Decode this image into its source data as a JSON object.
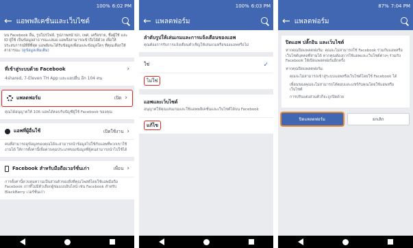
{
  "status": [
    {
      "time": "6:02 PM",
      "battery": "100%"
    },
    {
      "time": "6:03 PM",
      "battery": "100%"
    },
    {
      "time": "7:04 PM",
      "battery": "87%"
    }
  ],
  "screen1": {
    "title": "แอพพลิเคชั่นและเว็บไซต์",
    "intro": "บน Facebook อื่น, รูปโปรไฟล์, รูปภาพหน้าปก, เพศ, เครือข่าย, ชื่อผู้ใช้ และ ID ผู้ใช้ เป็นข้อมูลสาธารณะเสมอ แอพจึงสามารถเข้าถึงได้ด้วย เพื่อให้ประสบการณ์ที่ดีที่สุด แอพยังจะได้รับข้อมูลเพื่อนและข้อมูลใดๆ ที่คุณเลือกให้สาธารณะ",
    "intro_link": "(ดูข้อมูลเพิ่มเติม)",
    "login_title": "ที่เข้าสู่ระบบด้วย Facebook",
    "login_sub": "4shared, 7-Eleven TH App และแอปอื่น อีก 104 คน",
    "platform_title": "แพลตฟอร์ม",
    "platform_status": "เปิด",
    "platform_desc": "คุณได้อนุญาตให้ 106 แอพได้คอบรับบัญชีผู้ใช้ Facebook ของคุณ",
    "others_title": "แอพที่ผู้อื่นใช้",
    "others_status": "เปิดใช้งาน",
    "others_desc": "คนที่สามารถดูข้อมูลของคุณได้จะสามารถนำข้อมูลไปใช้กับแอพที่พวกเขาใช้งานได้ ให้การตั้งค่านี้เพื่อควบคุมประเภทของข้อมูลที่ผู้คนสามารถนำไปใช้ได้",
    "mobile_title": "Facebook สำหรับมือถือเวอร์ชั่นเก่า",
    "mobile_status": "เพื่อน",
    "mobile_desc": "การตั้งค่านี้ควบคุมความเป็นส่วนตัวของสิ่งที่คุณโพสต์โดยใช้แอพมือถือ Facebook เก่าที่ไม่มีตัวเลือกผู้ชมแบบอินไลน์ เช่น Facebook สำหรับ BlackBerry เวอร์ชั่นเก่า"
  },
  "screen2": {
    "title": "แพลตฟอร์ม",
    "section_title": "ลำดับรูปให้เล่นเกมและการแจ้งเตือนของแอพ",
    "section_desc": "คุณต้องการรับการแจ้งเตือนคำเชิญให้เล่นเกมหรือของแอพหรือไม่",
    "opt_yes": "ใช่",
    "opt_no": "ไม่ใช่",
    "apps_title": "แอพและเว็บไซต์",
    "apps_desc": "อนุญาตให้คุณเล่นเกมและใช้แอพพลิเคชั่นและเว็บไซต์ได้บน Facebook",
    "apps_value": "แก้ไข"
  },
  "screen3": {
    "title": "แพลตฟอร์ม",
    "dialog_title": "ปิดแอพ ปลั๊กอิน และเว็บไซต์",
    "p1": "หากคุณปิดแพลตฟอร์ม: คุณจะไม่สามารถใช้ Facebook ร่วมกับแอพหรือเว็บไซต์บุคคลที่สามได้ หากคุณต้องการใช้แอพและเว็บไซต์ต่างๆ ร่วมกับ Facebook ให้เปิดแพลตฟอร์มอีกครั้ง",
    "p2": "หากคุณปิดแพลตฟอร์ม:",
    "b1": "คุณจะไม่สามารถเข้าสู่ระบบแอพหรือเว็บไซต์โดยใช้ Facebook ได้",
    "b2": "เพื่อนของคุณจะไม่สามารถโต้ตอบและแชร์กับคุณโดยใช้แอพหรือเว็บไซต์",
    "b3": "การปรับแต่งส่วนตัวก็จะถูกปิดด้วย",
    "btn_confirm": "ปิดแพลตฟอร์ม",
    "btn_cancel": "ยกเลิก"
  },
  "colors": {
    "brand": "#4267b2",
    "highlight": "#d9281f",
    "focus": "#e78b3a"
  },
  "icons": [
    "back-arrow-icon",
    "search-icon",
    "gear-icon",
    "app-icon",
    "phone-icon",
    "chevron-right-icon",
    "check-icon"
  ]
}
